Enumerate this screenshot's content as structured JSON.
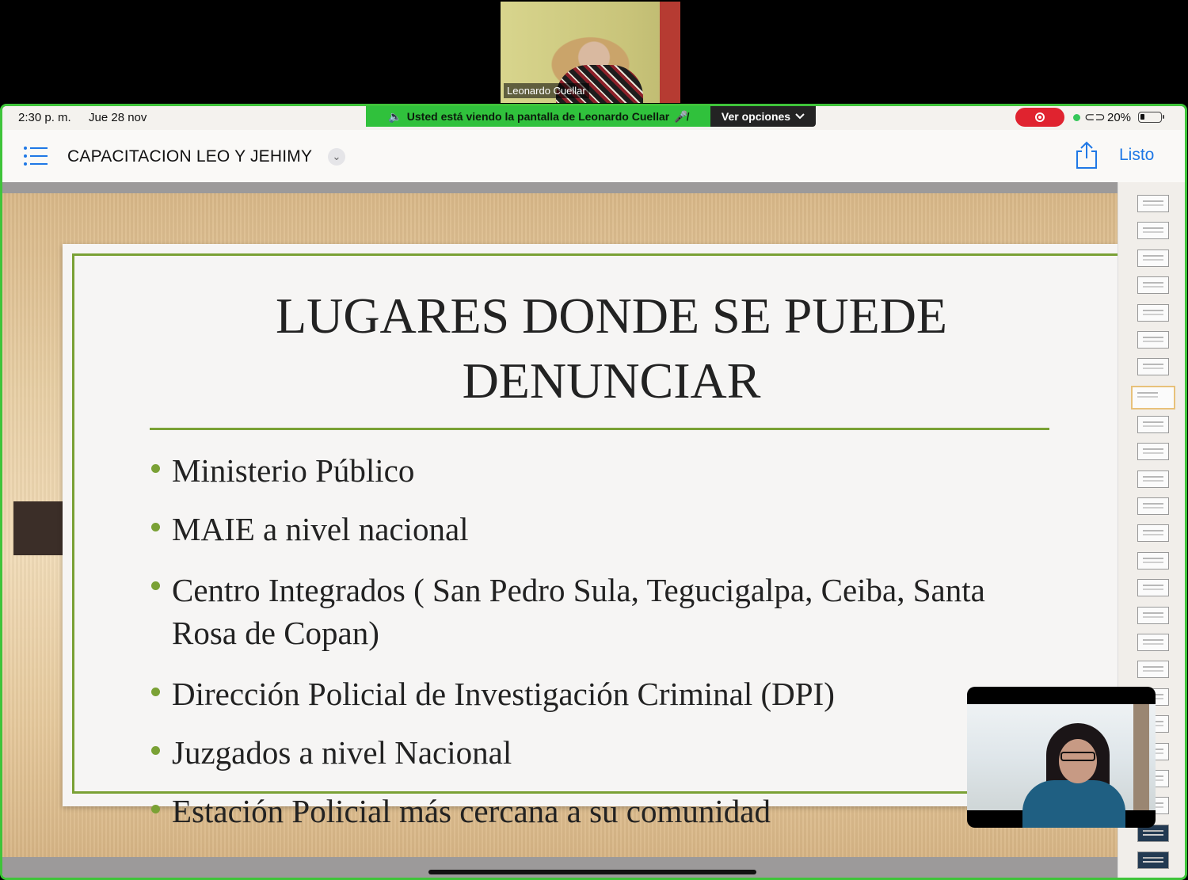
{
  "zoom": {
    "speaker_name": "Leonardo Cuellar",
    "share_banner": "Usted está viendo la pantalla de  Leonardo Cuellar",
    "view_options_label": "Ver opciones",
    "banner_color": "#30c13c",
    "frame_color": "#3fc43a",
    "record_color": "#e0232f"
  },
  "status_bar": {
    "time": "2:30 p. m.",
    "date": "Jue 28 nov",
    "battery": "20%"
  },
  "header": {
    "title": "CAPACITACION LEO Y JEHIMY",
    "done_label": "Listo",
    "accent_color": "#1f78e6"
  },
  "slide": {
    "title": "LUGARES DONDE SE PUEDE DENUNCIAR",
    "accent_color": "#7aa135",
    "bullets": [
      "Ministerio Público",
      "MAIE a nivel nacional",
      "Centro Integrados ( San Pedro Sula, Tegucigalpa, Ceiba, Santa Rosa de Copan)",
      "Dirección Policial de Investigación Criminal (DPI)",
      "Juzgados a nivel Nacional",
      "Estación Policial más cercana a su comunidad"
    ]
  },
  "thumbnails": {
    "count": 25,
    "selected_index": 7
  },
  "icons": {
    "list": "list-icon",
    "chevron": "chevron-down-icon",
    "share": "share-icon",
    "record": "record-icon",
    "speaker": "speaker-icon",
    "mic_off": "mic-off-icon",
    "link": "link-icon",
    "battery": "battery-icon"
  }
}
